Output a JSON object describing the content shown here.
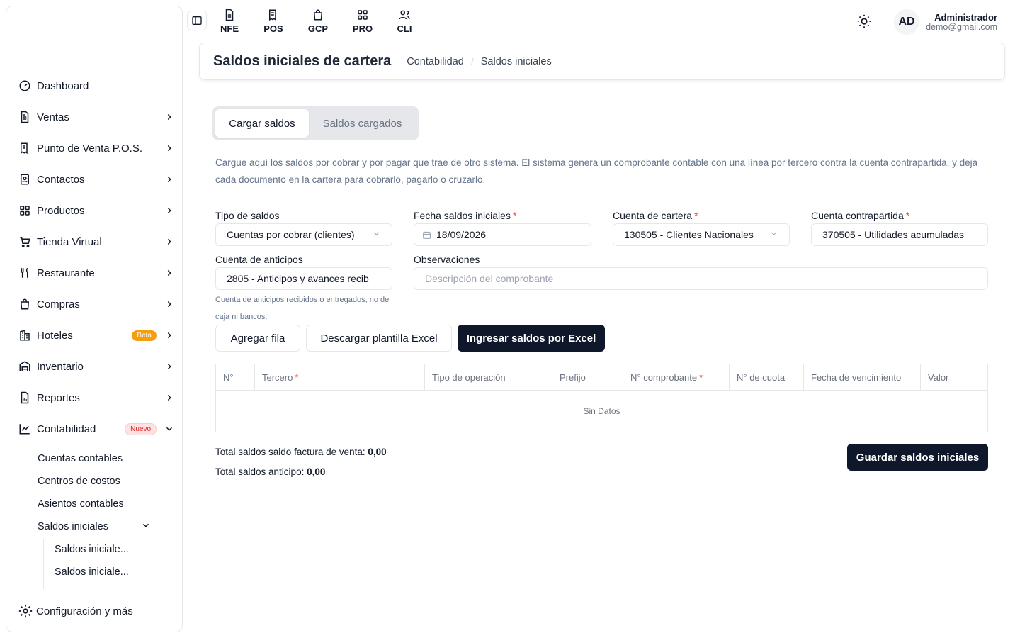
{
  "sidebar": {
    "items": [
      {
        "label": "Dashboard",
        "icon": "dashboard-icon"
      },
      {
        "label": "Ventas",
        "icon": "document-icon"
      },
      {
        "label": "Punto de Venta P.O.S.",
        "icon": "receipt-icon"
      },
      {
        "label": "Contactos",
        "icon": "contacts-icon"
      },
      {
        "label": "Productos",
        "icon": "grid-icon"
      },
      {
        "label": "Tienda Virtual",
        "icon": "cart-icon"
      },
      {
        "label": "Restaurante",
        "icon": "utensils-icon"
      },
      {
        "label": "Compras",
        "icon": "bag-icon"
      },
      {
        "label": "Hoteles",
        "icon": "building-icon",
        "badge": "Beta"
      },
      {
        "label": "Inventario",
        "icon": "warehouse-icon"
      },
      {
        "label": "Reportes",
        "icon": "report-icon"
      },
      {
        "label": "Contabilidad",
        "icon": "chart-icon",
        "badge": "Nuevo"
      }
    ],
    "submenu": [
      "Cuentas contables",
      "Centros de costos",
      "Asientos contables",
      "Saldos iniciales"
    ],
    "subsubmenu": [
      "Saldos iniciale...",
      "Saldos iniciale..."
    ],
    "config_label": "Configuración y más"
  },
  "topbar": {
    "apps": [
      {
        "label": "NFE",
        "icon": "file-icon"
      },
      {
        "label": "POS",
        "icon": "receipt-icon"
      },
      {
        "label": "GCP",
        "icon": "bag-icon"
      },
      {
        "label": "PRO",
        "icon": "grid-icon"
      },
      {
        "label": "CLI",
        "icon": "users-icon"
      }
    ],
    "avatar_initials": "AD",
    "user_name": "Administrador",
    "user_email": "demo@gmail.com"
  },
  "header": {
    "title": "Saldos iniciales de cartera",
    "breadcrumb": [
      "Contabilidad",
      "Saldos iniciales"
    ]
  },
  "tabs": [
    "Cargar saldos",
    "Saldos cargados"
  ],
  "description": "Cargue aquí los saldos por cobrar y por pagar que trae de otro sistema. El sistema genera un comprobante contable con una línea por tercero contra la cuenta contrapartida, y deja cada documento en la cartera para cobrarlo, pagarlo o cruzarlo.",
  "form": {
    "tipo_label": "Tipo de saldos",
    "tipo_value": "Cuentas por cobrar (clientes)",
    "fecha_label": "Fecha saldos iniciales",
    "fecha_value": "18/09/2026",
    "cartera_label": "Cuenta de cartera",
    "cartera_value": "130505 - Clientes Nacionales",
    "contrapartida_label": "Cuenta contrapartida",
    "contrapartida_value": "370505 - Utilidades acumuladas",
    "anticipos_label": "Cuenta de anticipos",
    "anticipos_value": "2805 - Anticipos y avances recib",
    "anticipos_hint": "Cuenta de anticipos recibidos o entregados, no de caja ni bancos.",
    "observaciones_label": "Observaciones",
    "observaciones_placeholder": "Descripción del comprobante",
    "required_mark": "*"
  },
  "buttons": {
    "agregar": "Agregar fila",
    "descargar": "Descargar plantilla Excel",
    "ingresar": "Ingresar saldos por Excel",
    "guardar": "Guardar saldos iniciales"
  },
  "table": {
    "columns": [
      "N°",
      "Tercero",
      "Tipo de operación",
      "Prefijo",
      "N° comprobante",
      "N° de cuota",
      "Fecha de vencimiento",
      "Valor"
    ],
    "empty_text": "Sin Datos"
  },
  "totals": {
    "venta_label": "Total saldos saldo factura de venta:",
    "venta_value": "0,00",
    "anticipo_label": "Total saldos anticipo:",
    "anticipo_value": "0,00"
  },
  "colors": {
    "primary_dark": "#0f172a",
    "required": "#ef4444",
    "badge_beta": "#f59e0b",
    "badge_new": "#dc2626"
  }
}
